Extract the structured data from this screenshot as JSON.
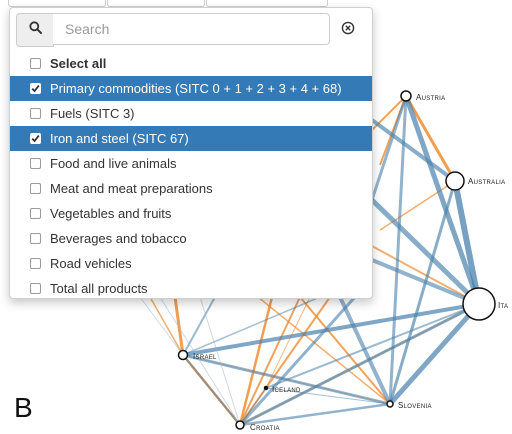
{
  "figure": {
    "panel_label": "B"
  },
  "network": {
    "nodes": [
      {
        "id": "austria",
        "label": "Austria",
        "r": 5
      },
      {
        "id": "australia",
        "label": "Australia",
        "r": 9
      },
      {
        "id": "italy",
        "label": "Ita",
        "r": 16
      },
      {
        "id": "slovenia",
        "label": "Slovenia",
        "r": 3
      },
      {
        "id": "croatia",
        "label": "Croatia",
        "r": 4
      },
      {
        "id": "iceland",
        "label": "Iceland",
        "r": 1.5
      },
      {
        "id": "israel",
        "label": "Israel",
        "r": 4.5
      }
    ],
    "series_colors": {
      "primary_commodities": "#4a82ad",
      "iron_and_steel": "#f08c32"
    }
  },
  "dropdown": {
    "search": {
      "placeholder": "Search",
      "value": "",
      "icon": "search-icon",
      "clear_icon": "clear-icon"
    },
    "options": [
      {
        "label": "Select all",
        "checked": false,
        "bold": true
      },
      {
        "label": "Primary commodities (SITC 0 + 1 + 2 + 3 + 4 + 68)",
        "checked": true
      },
      {
        "label": "Fuels (SITC 3)",
        "checked": false
      },
      {
        "label": "Iron and steel (SITC 67)",
        "checked": true
      },
      {
        "label": "Food and live animals",
        "checked": false
      },
      {
        "label": "Meat and meat preparations",
        "checked": false
      },
      {
        "label": "Vegetables and fruits",
        "checked": false
      },
      {
        "label": "Beverages and tobacco",
        "checked": false
      },
      {
        "label": "Road vehicles",
        "checked": false
      },
      {
        "label": "Total all products",
        "checked": false
      }
    ],
    "highlight_color": "#337ab7"
  }
}
